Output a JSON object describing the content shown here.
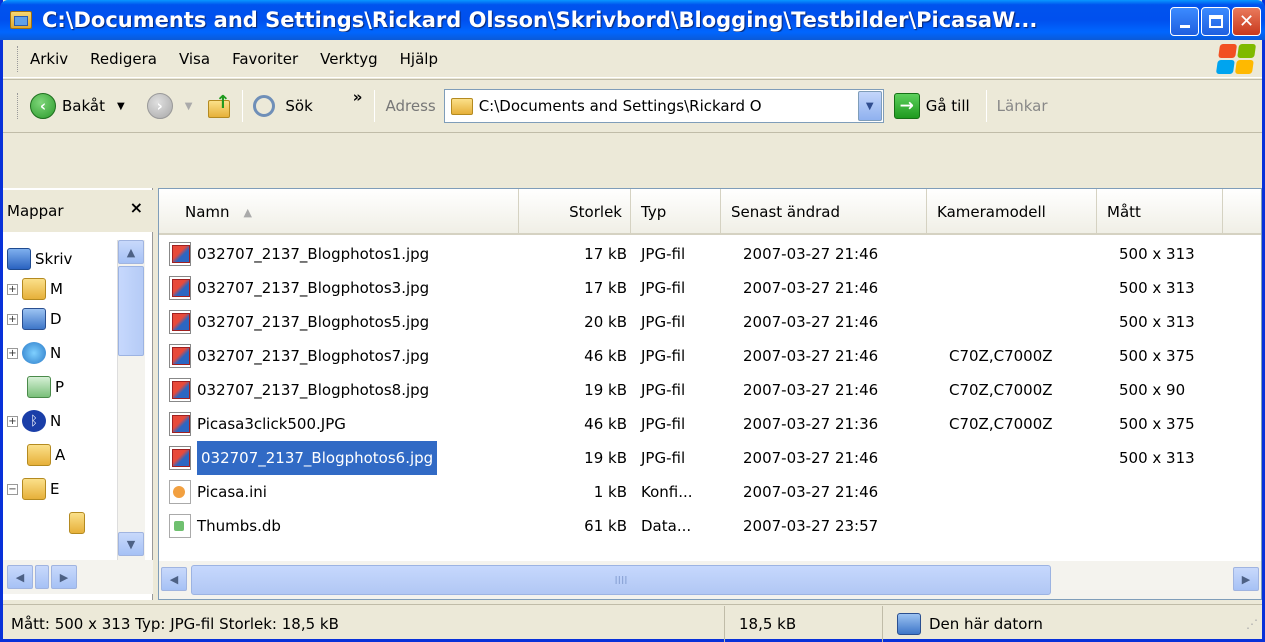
{
  "window": {
    "title": "C:\\Documents and Settings\\Rickard Olsson\\Skrivbord\\Blogging\\Testbilder\\PicasaW..."
  },
  "menu": [
    "Arkiv",
    "Redigera",
    "Visa",
    "Favoriter",
    "Verktyg",
    "Hjälp"
  ],
  "toolbar": {
    "back_label": "Bakåt",
    "search_label": "Sök",
    "more": "»",
    "address_label": "Adress",
    "address_value": "C:\\Documents and Settings\\Rickard O",
    "goto_label": "Gå till",
    "links_label": "Länkar"
  },
  "folders_pane": {
    "title": "Mappar",
    "close": "×",
    "tree": [
      {
        "label": "Skriv"
      },
      {
        "label": "M"
      },
      {
        "label": "D"
      },
      {
        "label": "N"
      },
      {
        "label": "P"
      },
      {
        "label": "N"
      },
      {
        "label": "A"
      },
      {
        "label": "E"
      }
    ]
  },
  "columns": [
    "Namn",
    "Storlek",
    "Typ",
    "Senast ändrad",
    "Kameramodell",
    "Mått"
  ],
  "sort_arrow": "▲",
  "files": [
    {
      "name": "032707_2137_Blogphotos1.jpg",
      "size": "17 kB",
      "type": "JPG-fil",
      "modified": "2007-03-27 21:46",
      "camera": "",
      "dims": "500 x 313",
      "icon": "jpg-icon",
      "selected": false
    },
    {
      "name": "032707_2137_Blogphotos3.jpg",
      "size": "17 kB",
      "type": "JPG-fil",
      "modified": "2007-03-27 21:46",
      "camera": "",
      "dims": "500 x 313",
      "icon": "jpg-icon",
      "selected": false
    },
    {
      "name": "032707_2137_Blogphotos5.jpg",
      "size": "20 kB",
      "type": "JPG-fil",
      "modified": "2007-03-27 21:46",
      "camera": "",
      "dims": "500 x 313",
      "icon": "jpg-icon",
      "selected": false
    },
    {
      "name": "032707_2137_Blogphotos7.jpg",
      "size": "46 kB",
      "type": "JPG-fil",
      "modified": "2007-03-27 21:46",
      "camera": "C70Z,C7000Z",
      "dims": "500 x 375",
      "icon": "jpg-icon",
      "selected": false
    },
    {
      "name": "032707_2137_Blogphotos8.jpg",
      "size": "19 kB",
      "type": "JPG-fil",
      "modified": "2007-03-27 21:46",
      "camera": "C70Z,C7000Z",
      "dims": "500 x 90",
      "icon": "jpg-icon",
      "selected": false
    },
    {
      "name": "Picasa3click500.JPG",
      "size": "46 kB",
      "type": "JPG-fil",
      "modified": "2007-03-27 21:36",
      "camera": "C70Z,C7000Z",
      "dims": "500 x 375",
      "icon": "jpg-icon",
      "selected": false
    },
    {
      "name": "032707_2137_Blogphotos6.jpg",
      "size": "19 kB",
      "type": "JPG-fil",
      "modified": "2007-03-27 21:46",
      "camera": "",
      "dims": "500 x 313",
      "icon": "jpg-icon",
      "selected": true
    },
    {
      "name": "Picasa.ini",
      "size": "1 kB",
      "type": "Konfi...",
      "modified": "2007-03-27 21:46",
      "camera": "",
      "dims": "",
      "icon": "ini-file-icon",
      "selected": false
    },
    {
      "name": "Thumbs.db",
      "size": "61 kB",
      "type": "Data...",
      "modified": "2007-03-27 23:57",
      "camera": "",
      "dims": "",
      "icon": "db-file-icon",
      "selected": false
    }
  ],
  "status": {
    "details": "Mått: 500 x 313 Typ: JPG-fil Storlek: 18,5 kB",
    "size": "18,5 kB",
    "location": "Den här datorn"
  },
  "scroll_glyph": "IIII",
  "colors": {
    "titlebar": "#0053ee",
    "selection": "#316ac5",
    "chrome": "#ece9d8"
  }
}
